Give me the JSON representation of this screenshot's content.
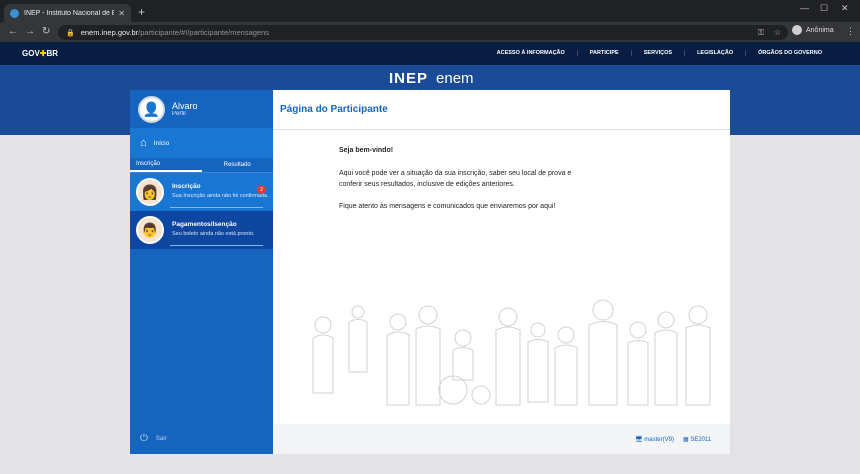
{
  "browser": {
    "tab_title": "INEP - Instituto Nacional de Estu",
    "url_host": "enem.inep.gov.br",
    "url_path": "/participante/#!/participante/mensagens",
    "profile": "Anônima"
  },
  "gov": {
    "logo": "GOV",
    "logo_suffix": "BR",
    "links": [
      "ACESSO À INFORMAÇÃO",
      "PARTICIPE",
      "SERVIÇOS",
      "LEGISLAÇÃO",
      "ÓRGÃOS DO GOVERNO"
    ]
  },
  "brand": {
    "left": "INEP",
    "right": "enem"
  },
  "sidebar": {
    "user_name": "Alvaro",
    "user_sub": "Perfil",
    "inicio": "Início",
    "tabs": [
      "Inscrição",
      "Resultado"
    ],
    "items": [
      {
        "title": "Inscrição",
        "desc": "Sua Inscrição ainda não foi confirmada.",
        "badge": "2"
      },
      {
        "title": "Pagamentos/Isenção",
        "desc": "Seu boleto ainda não está pronto."
      }
    ],
    "sair": "Sair"
  },
  "main": {
    "title": "Página do Participante",
    "welcome": "Seja bem-vindo!",
    "p1": "Aqui você pode ver a situação da sua inscrição, saber seu local de prova e conferir seus resultados, inclusive de edições anteriores.",
    "p2": "Fique atento às mensagens e comunicados que enviaremos por aqui!"
  },
  "footer": {
    "left": "master(V9)",
    "right": "SE2011"
  },
  "colors": {
    "gov_bar": "#071d41",
    "band": "#1b4b97",
    "sidebar": "#1565c0",
    "accent": "#1565c0"
  }
}
